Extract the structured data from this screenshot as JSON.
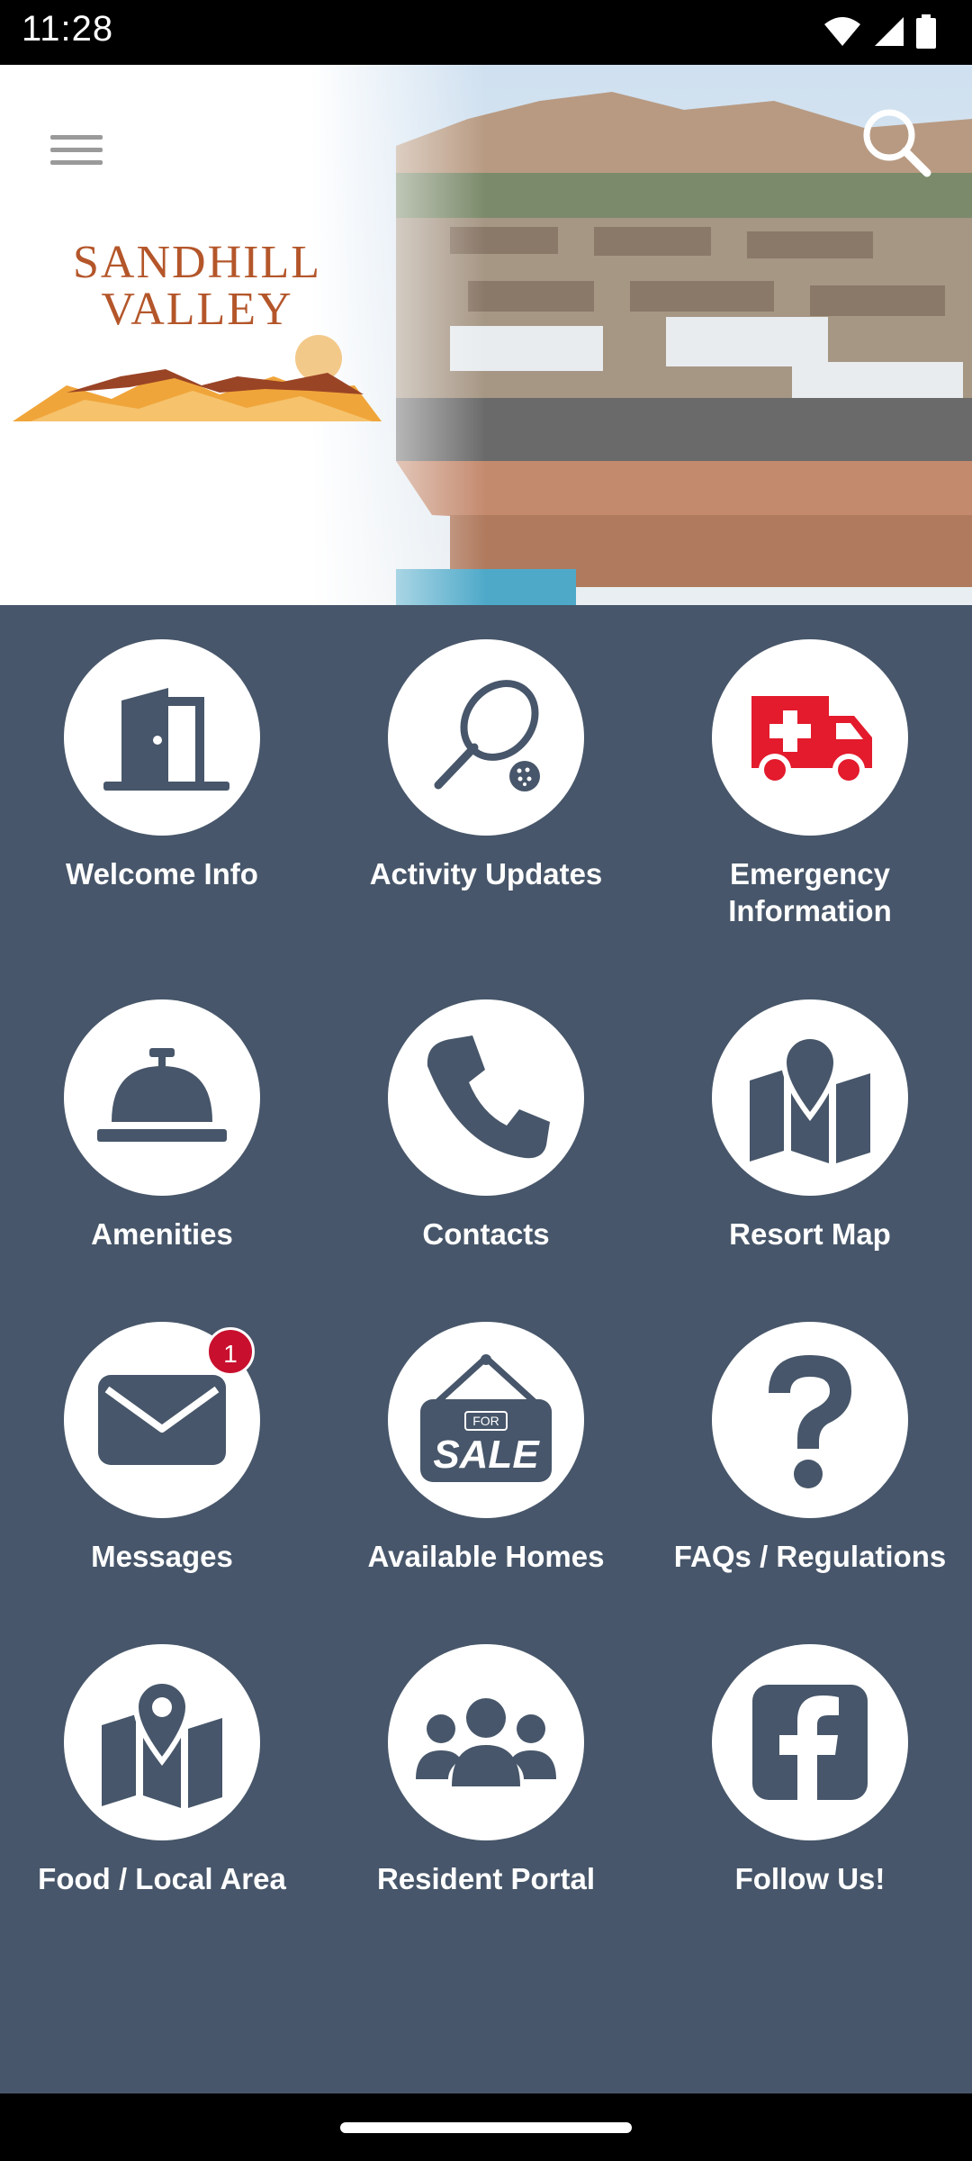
{
  "status_bar": {
    "time": "11:28"
  },
  "header": {
    "logo_line1": "SANDHILL",
    "logo_line2": "VALLEY"
  },
  "tiles": [
    {
      "label": "Welcome Info",
      "icon": "door-icon"
    },
    {
      "label": "Activity Updates",
      "icon": "pickleball-paddle-icon"
    },
    {
      "label": "Emergency Information",
      "icon": "ambulance-icon"
    },
    {
      "label": "Amenities",
      "icon": "service-bell-icon"
    },
    {
      "label": "Contacts",
      "icon": "phone-icon"
    },
    {
      "label": "Resort Map",
      "icon": "map-pin-icon"
    },
    {
      "label": "Messages",
      "icon": "envelope-icon",
      "badge": "1"
    },
    {
      "label": "Available Homes",
      "icon": "for-sale-sign-icon",
      "sign_small": "FOR",
      "sign_big": "SALE"
    },
    {
      "label": "FAQs / Regulations",
      "icon": "question-icon"
    },
    {
      "label": "Food / Local Area",
      "icon": "map-pin-icon"
    },
    {
      "label": "Resident Portal",
      "icon": "people-icon"
    },
    {
      "label": "Follow Us!",
      "icon": "facebook-icon"
    }
  ],
  "colors": {
    "background": "#47566a",
    "icon": "#47566a",
    "emergency_icon": "#e31b2d",
    "badge": "#c8102e",
    "logo_text": "#b4562a"
  }
}
